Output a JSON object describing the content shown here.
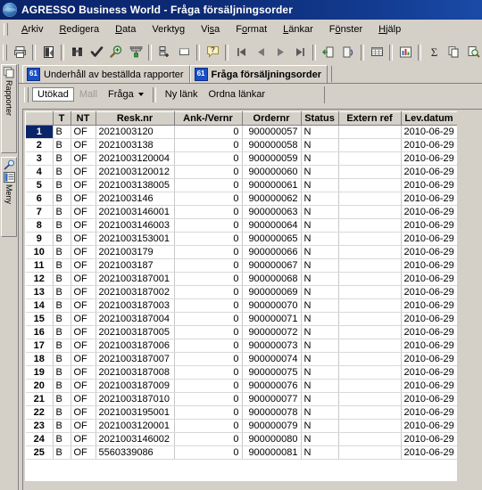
{
  "window": {
    "title": "AGRESSO Business World - Fråga försäljningsorder",
    "icon": "globe-icon"
  },
  "menubar": {
    "items": [
      {
        "label": "Arkiv",
        "accel": "A"
      },
      {
        "label": "Redigera",
        "accel": "R"
      },
      {
        "label": "Data",
        "accel": "D"
      },
      {
        "label": "Verktyg",
        "accel": "g"
      },
      {
        "label": "Visa",
        "accel": "s"
      },
      {
        "label": "Format",
        "accel": "o"
      },
      {
        "label": "Länkar",
        "accel": "L"
      },
      {
        "label": "Fönster",
        "accel": "ö"
      },
      {
        "label": "Hjälp",
        "accel": "H"
      }
    ]
  },
  "toolbar": {
    "buttons": [
      {
        "name": "print-icon",
        "title": "Skriv ut"
      },
      {
        "name": "page-setup-icon",
        "title": "Utskriftsformat"
      },
      {
        "name": "binoculars-search-icon",
        "title": "Sök"
      },
      {
        "name": "checkmark-icon",
        "title": "Godkänn"
      },
      {
        "name": "zoom-in-icon",
        "title": "Zooma"
      },
      {
        "name": "hierarchy-icon",
        "title": "Hierarki"
      },
      {
        "name": "add-row-icon",
        "title": "Lägg till rad"
      },
      {
        "name": "blank-window-icon",
        "title": "Nytt fönster"
      },
      {
        "name": "help-question-icon",
        "title": "Hjälp"
      },
      {
        "name": "first-record-icon",
        "title": "Första"
      },
      {
        "name": "previous-record-icon",
        "title": "Föregående"
      },
      {
        "name": "next-record-icon",
        "title": "Nästa"
      },
      {
        "name": "last-record-icon",
        "title": "Sista"
      },
      {
        "name": "import-icon",
        "title": "Importera"
      },
      {
        "name": "export-icon",
        "title": "Exportera"
      },
      {
        "name": "table-view-icon",
        "title": "Tabellvy"
      },
      {
        "name": "bar-chart-icon",
        "title": "Diagram"
      },
      {
        "name": "sigma-sum-icon",
        "title": "Summa"
      },
      {
        "name": "copy-icon",
        "title": "Kopiera"
      },
      {
        "name": "print-preview-icon",
        "title": "Förhandsgranska"
      },
      {
        "name": "print-setup-icon",
        "title": "Skrivarinställning"
      },
      {
        "name": "clipboard-icon",
        "title": "Urklipp"
      }
    ]
  },
  "sidebar": {
    "tabs": [
      {
        "label": "Rapporter",
        "icon": "documents-icon"
      },
      {
        "label": "Meny",
        "icon": "menu-list-icon"
      }
    ],
    "magnifier_icon": "magnifier-icon"
  },
  "document_tabs": [
    {
      "label": "Underhåll av beställda rapporter",
      "icon_text": "61",
      "active": false
    },
    {
      "label": "Fråga försäljningsorder",
      "icon_text": "61",
      "active": true
    }
  ],
  "subtoolbar": {
    "buttons": [
      {
        "label": "Utökad",
        "state": "pressed"
      },
      {
        "label": "Mall",
        "state": "disabled"
      },
      {
        "label": "Fråga",
        "state": "normal",
        "has_dropdown": true
      },
      {
        "label": "Ny länk",
        "state": "normal"
      },
      {
        "label": "Ordna länkar",
        "state": "normal"
      }
    ]
  },
  "grid": {
    "columns": [
      {
        "key": "rownum",
        "label": ""
      },
      {
        "key": "t",
        "label": "T"
      },
      {
        "key": "nt",
        "label": "NT"
      },
      {
        "key": "resk",
        "label": "Resk.nr"
      },
      {
        "key": "ank",
        "label": "Ank-/Vernr"
      },
      {
        "key": "order",
        "label": "Ordernr"
      },
      {
        "key": "status",
        "label": "Status"
      },
      {
        "key": "extern",
        "label": "Extern ref"
      },
      {
        "key": "lev",
        "label": "Lev.datum"
      }
    ],
    "selected_row": 1,
    "rows": [
      {
        "n": "1",
        "t": "B",
        "nt": "OF",
        "resk": "2021003120",
        "ank": "0",
        "order": "900000057",
        "status": "N",
        "extern": "",
        "lev": "2010-06-29"
      },
      {
        "n": "2",
        "t": "B",
        "nt": "OF",
        "resk": "2021003138",
        "ank": "0",
        "order": "900000058",
        "status": "N",
        "extern": "",
        "lev": "2010-06-29"
      },
      {
        "n": "3",
        "t": "B",
        "nt": "OF",
        "resk": "2021003120004",
        "ank": "0",
        "order": "900000059",
        "status": "N",
        "extern": "",
        "lev": "2010-06-29"
      },
      {
        "n": "4",
        "t": "B",
        "nt": "OF",
        "resk": "2021003120012",
        "ank": "0",
        "order": "900000060",
        "status": "N",
        "extern": "",
        "lev": "2010-06-29"
      },
      {
        "n": "5",
        "t": "B",
        "nt": "OF",
        "resk": "2021003138005",
        "ank": "0",
        "order": "900000061",
        "status": "N",
        "extern": "",
        "lev": "2010-06-29"
      },
      {
        "n": "6",
        "t": "B",
        "nt": "OF",
        "resk": "2021003146",
        "ank": "0",
        "order": "900000062",
        "status": "N",
        "extern": "",
        "lev": "2010-06-29"
      },
      {
        "n": "7",
        "t": "B",
        "nt": "OF",
        "resk": "2021003146001",
        "ank": "0",
        "order": "900000063",
        "status": "N",
        "extern": "",
        "lev": "2010-06-29"
      },
      {
        "n": "8",
        "t": "B",
        "nt": "OF",
        "resk": "2021003146003",
        "ank": "0",
        "order": "900000064",
        "status": "N",
        "extern": "",
        "lev": "2010-06-29"
      },
      {
        "n": "9",
        "t": "B",
        "nt": "OF",
        "resk": "2021003153001",
        "ank": "0",
        "order": "900000065",
        "status": "N",
        "extern": "",
        "lev": "2010-06-29"
      },
      {
        "n": "10",
        "t": "B",
        "nt": "OF",
        "resk": "2021003179",
        "ank": "0",
        "order": "900000066",
        "status": "N",
        "extern": "",
        "lev": "2010-06-29"
      },
      {
        "n": "11",
        "t": "B",
        "nt": "OF",
        "resk": "2021003187",
        "ank": "0",
        "order": "900000067",
        "status": "N",
        "extern": "",
        "lev": "2010-06-29"
      },
      {
        "n": "12",
        "t": "B",
        "nt": "OF",
        "resk": "2021003187001",
        "ank": "0",
        "order": "900000068",
        "status": "N",
        "extern": "",
        "lev": "2010-06-29"
      },
      {
        "n": "13",
        "t": "B",
        "nt": "OF",
        "resk": "2021003187002",
        "ank": "0",
        "order": "900000069",
        "status": "N",
        "extern": "",
        "lev": "2010-06-29"
      },
      {
        "n": "14",
        "t": "B",
        "nt": "OF",
        "resk": "2021003187003",
        "ank": "0",
        "order": "900000070",
        "status": "N",
        "extern": "",
        "lev": "2010-06-29"
      },
      {
        "n": "15",
        "t": "B",
        "nt": "OF",
        "resk": "2021003187004",
        "ank": "0",
        "order": "900000071",
        "status": "N",
        "extern": "",
        "lev": "2010-06-29"
      },
      {
        "n": "16",
        "t": "B",
        "nt": "OF",
        "resk": "2021003187005",
        "ank": "0",
        "order": "900000072",
        "status": "N",
        "extern": "",
        "lev": "2010-06-29"
      },
      {
        "n": "17",
        "t": "B",
        "nt": "OF",
        "resk": "2021003187006",
        "ank": "0",
        "order": "900000073",
        "status": "N",
        "extern": "",
        "lev": "2010-06-29"
      },
      {
        "n": "18",
        "t": "B",
        "nt": "OF",
        "resk": "2021003187007",
        "ank": "0",
        "order": "900000074",
        "status": "N",
        "extern": "",
        "lev": "2010-06-29"
      },
      {
        "n": "19",
        "t": "B",
        "nt": "OF",
        "resk": "2021003187008",
        "ank": "0",
        "order": "900000075",
        "status": "N",
        "extern": "",
        "lev": "2010-06-29"
      },
      {
        "n": "20",
        "t": "B",
        "nt": "OF",
        "resk": "2021003187009",
        "ank": "0",
        "order": "900000076",
        "status": "N",
        "extern": "",
        "lev": "2010-06-29"
      },
      {
        "n": "21",
        "t": "B",
        "nt": "OF",
        "resk": "2021003187010",
        "ank": "0",
        "order": "900000077",
        "status": "N",
        "extern": "",
        "lev": "2010-06-29"
      },
      {
        "n": "22",
        "t": "B",
        "nt": "OF",
        "resk": "2021003195001",
        "ank": "0",
        "order": "900000078",
        "status": "N",
        "extern": "",
        "lev": "2010-06-29"
      },
      {
        "n": "23",
        "t": "B",
        "nt": "OF",
        "resk": "2021003120001",
        "ank": "0",
        "order": "900000079",
        "status": "N",
        "extern": "",
        "lev": "2010-06-29"
      },
      {
        "n": "24",
        "t": "B",
        "nt": "OF",
        "resk": "2021003146002",
        "ank": "0",
        "order": "900000080",
        "status": "N",
        "extern": "",
        "lev": "2010-06-29"
      },
      {
        "n": "25",
        "t": "B",
        "nt": "OF",
        "resk": "5560339086",
        "ank": "0",
        "order": "900000081",
        "status": "N",
        "extern": "",
        "lev": "2010-06-29"
      }
    ]
  },
  "colors": {
    "titlebar_start": "#0a246a",
    "titlebar_end": "#1a4aa8",
    "chrome": "#d4d0c8",
    "selection": "#0a246a",
    "grid_bg": "#ffffff",
    "tab_icon": "#1a4fc4"
  }
}
